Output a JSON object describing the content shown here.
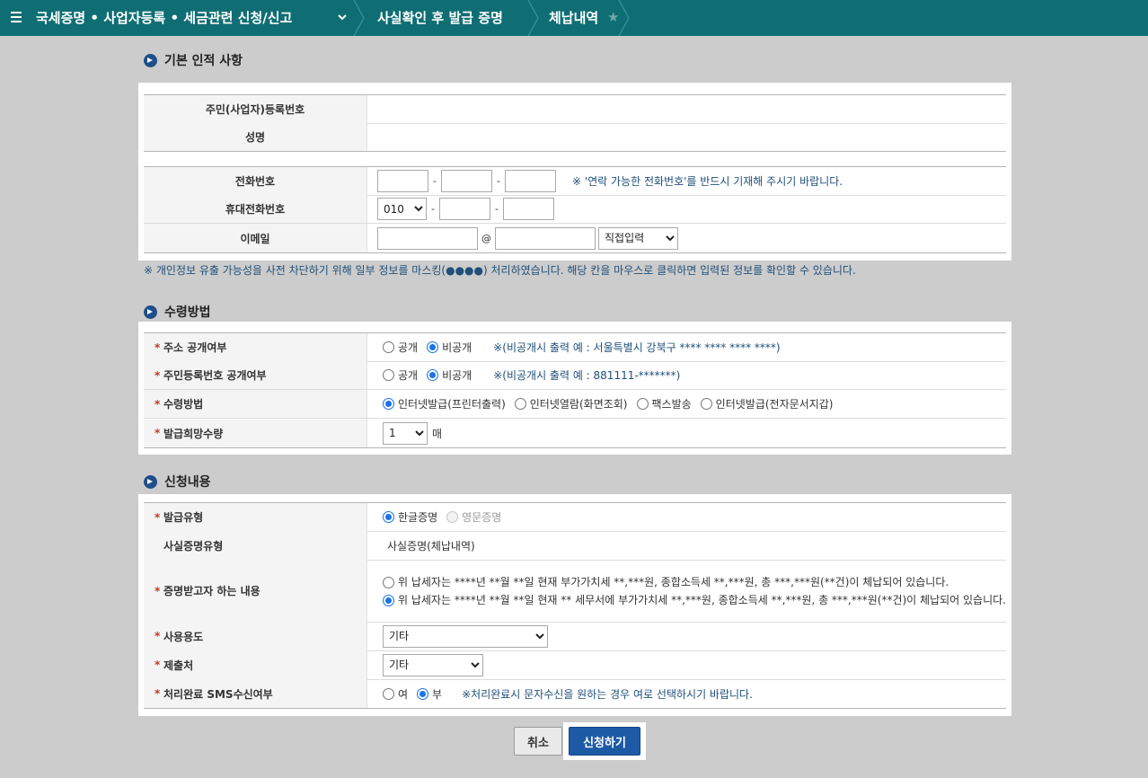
{
  "nav": {
    "crumb1": "국세증명 • 사업자등록 • 세금관련 신청/신고",
    "crumb2": "사실확인 후 발급 증명",
    "crumb3": "체납내역",
    "star": "★"
  },
  "section_basic": {
    "title": "기본 인적 사항",
    "rows": {
      "regno_label": "주민(사업자)등록번호",
      "name_label": "성명",
      "phone_label": "전화번호",
      "phone_note": "※ '연락 가능한 전화번호'를 반드시 기재해 주시기 바랍니다.",
      "mobile_label": "휴대전화번호",
      "mobile_prefix": "010",
      "email_label": "이메일",
      "email_at": "@",
      "email_domain_select": "직접입력"
    },
    "dash": "-",
    "privacy_note": "※ 개인정보 유출 가능성을 사전 차단하기 위해 일부 정보를 마스킹(●●●●) 처리하였습니다. 해당 칸을 마우스로 클릭하면 입력된 정보를 확인할 수 있습니다."
  },
  "section_receive": {
    "title": "수령방법",
    "req": "*",
    "address_label": "주소 공개여부",
    "address_opt_public": "공개",
    "address_opt_private": "비공개",
    "address_note": "※(비공개시 출력 예 : 서울특별시 강북구 **** **** **** ****)",
    "rrn_label": "주민등록번호 공개여부",
    "rrn_opt_public": "공개",
    "rrn_opt_private": "비공개",
    "rrn_note": "※(비공개시 출력 예 : 881111-*******)",
    "method_label": "수령방법",
    "method_opt1": "인터넷발급(프린터출력)",
    "method_opt2": "인터넷열람(화면조회)",
    "method_opt3": "팩스발송",
    "method_opt4": "인터넷발급(전자문서지갑)",
    "qty_label": "발급희망수량",
    "qty_value": "1",
    "qty_unit": "매"
  },
  "section_request": {
    "title": "신청내용",
    "req": "*",
    "type_label": "발급유형",
    "type_opt_kor": "한글증명",
    "type_opt_eng": "영문증명",
    "cert_type_label": "사실증명유형",
    "cert_type_value": "사실증명(체납내역)",
    "content_label": "증명받고자 하는 내용",
    "content_opt1": "위 납세자는 ****년 **월 **일 현재 부가가치세 **,***원, 종합소득세 **,***원, 총 ***,***원(**건)이 체납되어 있습니다.",
    "content_opt2": "위 납세자는 ****년 **월 **일 현재 ** 세무서에 부가가치세 **,***원, 종합소득세 **,***원, 총 ***,***원(**건)이 체납되어 있습니다.",
    "usage_label": "사용용도",
    "usage_value": "기타",
    "submit_to_label": "제출처",
    "submit_to_value": "기타",
    "sms_label": "처리완료 SMS수신여부",
    "sms_opt_yes": "여",
    "sms_opt_no": "부",
    "sms_note": "※처리완료시 문자수신을 원하는 경우 여로 선택하시기 바랍니다."
  },
  "buttons": {
    "cancel": "취소",
    "submit": "신청하기"
  }
}
